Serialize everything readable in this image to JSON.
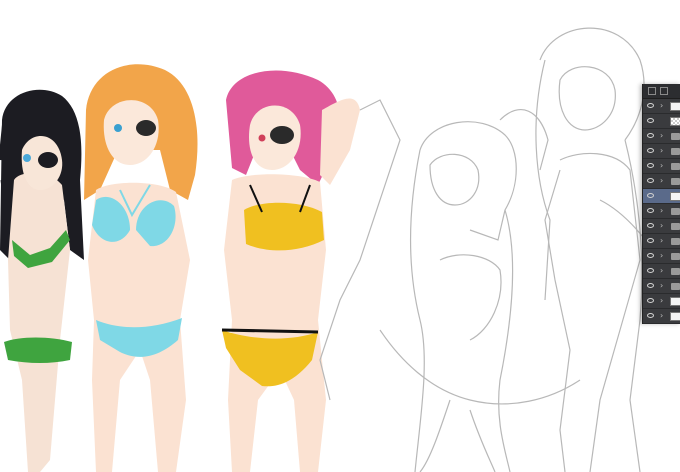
{
  "app": {
    "canvas_background": "#ffffff",
    "panel_background": "#3a3b3e",
    "selected_row_color": "#5a6a8a"
  },
  "canvas": {
    "artwork": "anime illustration: three swimsuit girls (colored) and line-art sketch of two more figures",
    "figures": [
      {
        "name": "black-hair-girl",
        "hair": "#1c1c22",
        "swimsuit": "#3fa43f"
      },
      {
        "name": "blonde-girl",
        "hair": "#f2a54a",
        "swimsuit": "#7fd8e6"
      },
      {
        "name": "pink-hair-girl",
        "hair": "#e05a9a",
        "swimsuit": "#f0c020"
      },
      {
        "name": "sketch-figure-left",
        "hair": "none",
        "swimsuit": "none"
      },
      {
        "name": "sketch-figure-right",
        "hair": "none",
        "swimsuit": "none"
      }
    ]
  },
  "layers_panel": {
    "rows": [
      {
        "icon": "eye-icon",
        "kind": "layer",
        "arrow": "›"
      },
      {
        "icon": "eye-icon",
        "kind": "layer-checker",
        "arrow": ""
      },
      {
        "icon": "eye-icon",
        "kind": "folder",
        "arrow": "›"
      },
      {
        "icon": "eye-icon",
        "kind": "folder",
        "arrow": "›"
      },
      {
        "icon": "eye-icon",
        "kind": "folder",
        "arrow": "›"
      },
      {
        "icon": "eye-icon",
        "kind": "folder",
        "arrow": "›"
      },
      {
        "icon": "eye-icon",
        "kind": "layer-selected",
        "arrow": ""
      },
      {
        "icon": "eye-icon",
        "kind": "folder",
        "arrow": "›"
      },
      {
        "icon": "eye-icon",
        "kind": "folder",
        "arrow": "›"
      },
      {
        "icon": "eye-icon",
        "kind": "folder",
        "arrow": "›"
      },
      {
        "icon": "eye-icon",
        "kind": "folder",
        "arrow": "›"
      },
      {
        "icon": "eye-icon",
        "kind": "folder",
        "arrow": "›"
      },
      {
        "icon": "eye-icon",
        "kind": "folder",
        "arrow": "›"
      },
      {
        "icon": "eye-icon",
        "kind": "layer",
        "arrow": "›"
      },
      {
        "icon": "eye-icon",
        "kind": "layer",
        "arrow": "›"
      }
    ]
  }
}
